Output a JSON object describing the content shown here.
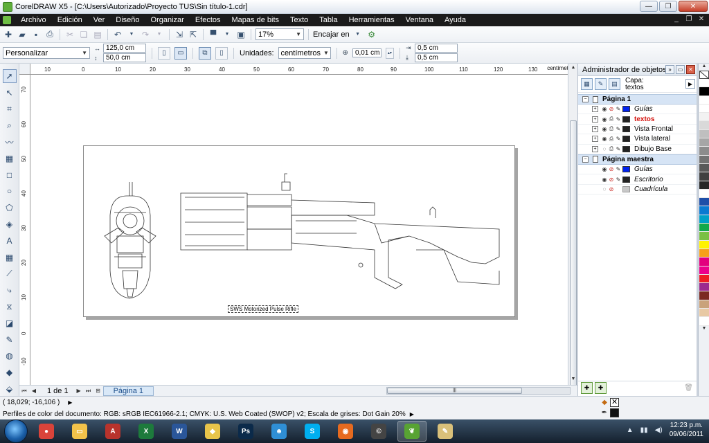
{
  "window": {
    "title": "CorelDRAW X5 - [C:\\Users\\Autorizado\\Proyecto TUS\\Sin título-1.cdr]",
    "min_icon": "minimize-icon",
    "max_icon": "maximize-icon",
    "close_icon": "close-icon"
  },
  "menu": {
    "items": [
      "Archivo",
      "Edición",
      "Ver",
      "Diseño",
      "Organizar",
      "Efectos",
      "Mapas de bits",
      "Texto",
      "Tabla",
      "Herramientas",
      "Ventana",
      "Ayuda"
    ]
  },
  "toolbar": {
    "zoom_value": "17%",
    "snap_label": "Encajar en"
  },
  "propbar": {
    "page_preset": "Personalizar",
    "width": "125,0 cm",
    "height": "50,0 cm",
    "units_label": "Unidades:",
    "units_value": "centímetros",
    "nudge": "0,01 cm",
    "dup_x": "0,5 cm",
    "dup_y": "0,5 cm"
  },
  "rulers": {
    "top_ticks": [
      "10",
      "0",
      "10",
      "20",
      "30",
      "40",
      "50",
      "60",
      "70",
      "80",
      "90",
      "100",
      "110",
      "120",
      "130"
    ],
    "left_ticks": [
      "70",
      "60",
      "50",
      "40",
      "30",
      "20",
      "10",
      "0",
      "-10"
    ],
    "unit": "centímetros"
  },
  "drawing": {
    "caption": "SWS Motorized Pulse Rifle"
  },
  "navigator": {
    "page_count": "1 de 1",
    "page_tab": "Página 1"
  },
  "docker": {
    "title": "Administrador de objetos",
    "layer_caption_label": "Capa:",
    "layer_caption_value": "textos",
    "page1": {
      "label": "Página 1",
      "layers": [
        {
          "name": "Guías",
          "color": "#0022ee",
          "italic": true,
          "active": false
        },
        {
          "name": "textos",
          "color": "#222222",
          "italic": false,
          "active": true
        },
        {
          "name": "Vista Frontal",
          "color": "#222222",
          "italic": false,
          "active": false
        },
        {
          "name": "Vista lateral",
          "color": "#222222",
          "italic": false,
          "active": false
        },
        {
          "name": "Dibujo Base",
          "color": "#222222",
          "italic": false,
          "active": false
        }
      ]
    },
    "master": {
      "label": "Página maestra",
      "layers": [
        {
          "name": "Guías",
          "color": "#0022ee",
          "italic": true
        },
        {
          "name": "Escritorio",
          "color": "#222222",
          "italic": true
        },
        {
          "name": "Cuadrícula",
          "color": "#c8c8c8",
          "italic": true
        }
      ]
    }
  },
  "palette": {
    "colors": [
      "#ffffff",
      "#000000",
      "#ffffff",
      "#ffffff",
      "#f2f2f2",
      "#d9d9d9",
      "#bfbfbf",
      "#a6a6a6",
      "#8c8c8c",
      "#737373",
      "#595959",
      "#404040",
      "#262626",
      "#ffffff",
      "#1e4fa8",
      "#0a7ad1",
      "#00a0c8",
      "#13a94a",
      "#7ac043",
      "#fff200",
      "#f7a11a",
      "#e3007e",
      "#ec008c",
      "#ee1d24",
      "#9b2a8f",
      "#7b2a22",
      "#c9a27a",
      "#e8c9a4",
      "#ffffff"
    ]
  },
  "status": {
    "coords": "( 18,029; -16,106 )",
    "color_profiles": "Perfiles de color del documento: RGB: sRGB IEC61966-2.1; CMYK: U.S. Web Coated (SWOP) v2; Escala de grises: Dot Gain 20%"
  },
  "taskbar": {
    "apps": [
      {
        "icon": "chrome-icon",
        "bg": "#d9433a",
        "glyph": "●"
      },
      {
        "icon": "folder-icon",
        "bg": "#f2c24a",
        "glyph": "▭"
      },
      {
        "icon": "access-icon",
        "bg": "#b8332c",
        "glyph": "A"
      },
      {
        "icon": "excel-icon",
        "bg": "#1d7a3c",
        "glyph": "X"
      },
      {
        "icon": "word-icon",
        "bg": "#2a5699",
        "glyph": "W"
      },
      {
        "icon": "explorer-icon",
        "bg": "#e8c44a",
        "glyph": "◆"
      },
      {
        "icon": "photoshop-icon",
        "bg": "#0b2a4a",
        "glyph": "Ps"
      },
      {
        "icon": "messenger-icon",
        "bg": "#2f8fd6",
        "glyph": "☻"
      },
      {
        "icon": "skype-icon",
        "bg": "#00aff0",
        "glyph": "S"
      },
      {
        "icon": "firefox-icon",
        "bg": "#e66a1f",
        "glyph": "◉"
      },
      {
        "icon": "ccleaner-icon",
        "bg": "#444444",
        "glyph": "©"
      },
      {
        "icon": "coreldraw-icon",
        "bg": "#58a333",
        "glyph": "❦"
      },
      {
        "icon": "paint-icon",
        "bg": "#d9c07a",
        "glyph": "✎"
      }
    ],
    "time": "12:23 p.m.",
    "date": "09/06/2011"
  }
}
